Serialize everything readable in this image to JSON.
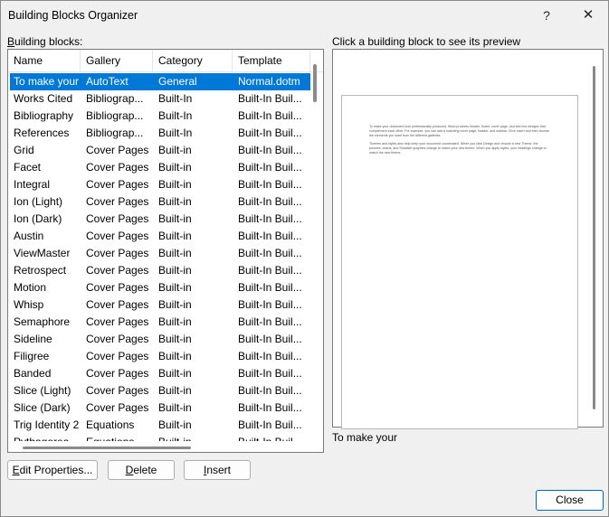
{
  "window": {
    "title": "Building Blocks Organizer",
    "help_glyph": "?",
    "close_glyph": "✕"
  },
  "blocks_label": {
    "accel": "B",
    "rest": "uilding blocks:"
  },
  "preview_label": "Click a building block to see its preview",
  "list": {
    "headers": [
      "Name",
      "Gallery",
      "Category",
      "Template"
    ],
    "selected_index": 0,
    "rows": [
      [
        "To make your",
        "AutoText",
        "General",
        "Normal.dotm"
      ],
      [
        "Works Cited",
        "Bibliograp...",
        "Built-In",
        "Built-In Buil..."
      ],
      [
        "Bibliography",
        "Bibliograp...",
        "Built-In",
        "Built-In Buil..."
      ],
      [
        "References",
        "Bibliograp...",
        "Built-In",
        "Built-In Buil..."
      ],
      [
        "Grid",
        "Cover Pages",
        "Built-in",
        "Built-In Buil..."
      ],
      [
        "Facet",
        "Cover Pages",
        "Built-in",
        "Built-In Buil..."
      ],
      [
        "Integral",
        "Cover Pages",
        "Built-in",
        "Built-In Buil..."
      ],
      [
        "Ion (Light)",
        "Cover Pages",
        "Built-in",
        "Built-In Buil..."
      ],
      [
        "Ion (Dark)",
        "Cover Pages",
        "Built-in",
        "Built-In Buil..."
      ],
      [
        "Austin",
        "Cover Pages",
        "Built-in",
        "Built-In Buil..."
      ],
      [
        "ViewMaster",
        "Cover Pages",
        "Built-in",
        "Built-In Buil..."
      ],
      [
        "Retrospect",
        "Cover Pages",
        "Built-in",
        "Built-In Buil..."
      ],
      [
        "Motion",
        "Cover Pages",
        "Built-in",
        "Built-In Buil..."
      ],
      [
        "Whisp",
        "Cover Pages",
        "Built-in",
        "Built-In Buil..."
      ],
      [
        "Semaphore",
        "Cover Pages",
        "Built-in",
        "Built-In Buil..."
      ],
      [
        "Sideline",
        "Cover Pages",
        "Built-in",
        "Built-In Buil..."
      ],
      [
        "Filigree",
        "Cover Pages",
        "Built-in",
        "Built-In Buil..."
      ],
      [
        "Banded",
        "Cover Pages",
        "Built-in",
        "Built-In Buil..."
      ],
      [
        "Slice (Light)",
        "Cover Pages",
        "Built-in",
        "Built-In Buil..."
      ],
      [
        "Slice (Dark)",
        "Cover Pages",
        "Built-in",
        "Built-In Buil..."
      ],
      [
        "Trig Identity 2",
        "Equations",
        "Built-in",
        "Built-In Buil..."
      ],
      [
        "Pythagorea...",
        "Equations",
        "Built-in",
        "Built-In Buil..."
      ]
    ]
  },
  "preview": {
    "paragraph1": "To make your document look professionally produced, Word provides header, footer, cover page, and text box designs that complement each other. For example, you can add a matching cover page, header, and sidebar. Click Insert and then choose the elements you want from the different galleries.",
    "paragraph2": "Themes and styles also help keep your document coordinated. When you click Design and choose a new Theme, the pictures, charts, and SmartArt graphics change to match your new theme. When you apply styles, your headings change to match the new theme.",
    "caption": "To make your"
  },
  "buttons": {
    "edit": {
      "accel": "E",
      "rest": "dit Properties..."
    },
    "delete": {
      "accel": "D",
      "rest": "elete"
    },
    "insert": {
      "accel": "I",
      "rest": "nsert"
    },
    "close": "Close"
  },
  "colors": {
    "selection": "#0078d7",
    "default_button_border": "#0067c0"
  }
}
